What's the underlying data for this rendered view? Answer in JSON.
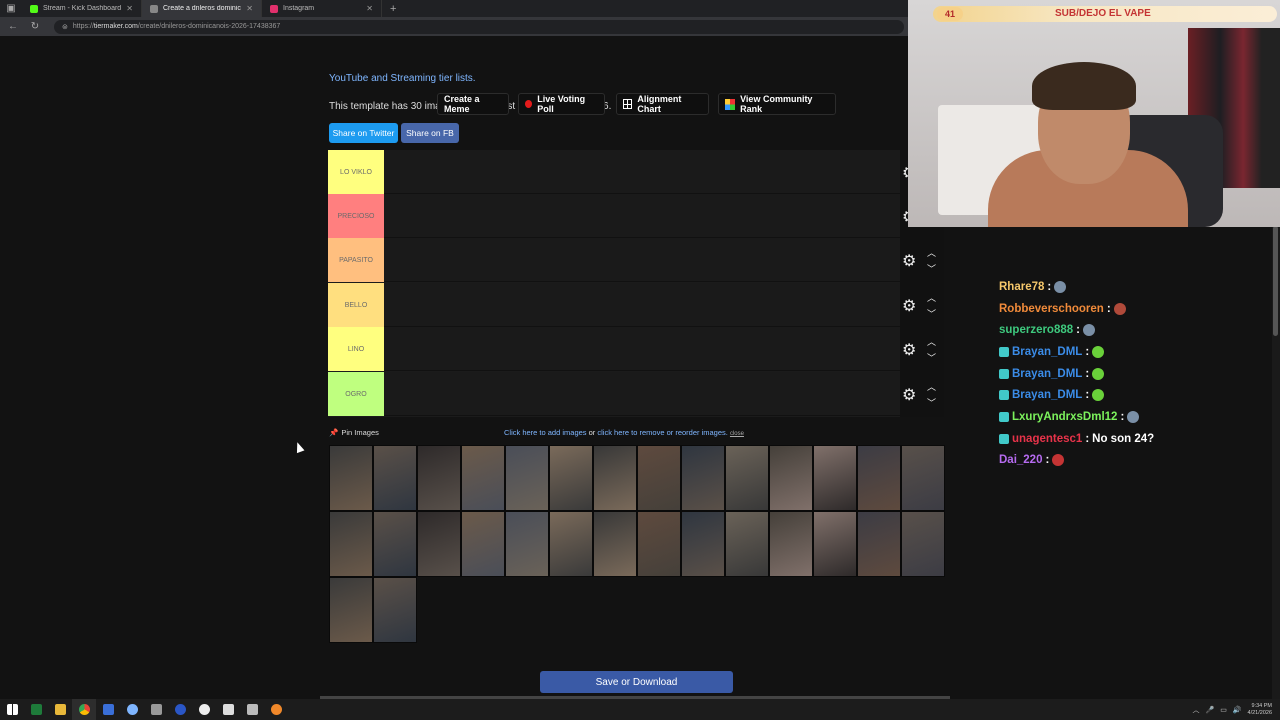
{
  "browser": {
    "tabs": [
      {
        "label": "Stream - Kick Dashboard",
        "color": "#53fc18"
      },
      {
        "label": "Create a dnleros dominicanois 20...",
        "color": "#888888"
      },
      {
        "label": "Instagram",
        "color": "#e1306c"
      }
    ],
    "url_domain": "tiermaker.com",
    "url_path": "/create/dnileros-dominicanois-2026-17438367",
    "url_prefix": "https://"
  },
  "page": {
    "link_text": "YouTube and Streaming tier lists.",
    "info_text": "This template has 30 images and was last modified 01/04/2026.",
    "buttons": {
      "create_meme": "Create a Meme",
      "live_poll": "Live Voting Poll",
      "alignment": "Alignment Chart",
      "community": "View Community Rank"
    },
    "share_twitter": "Share on Twitter",
    "share_fb": "Share on FB",
    "tiers": [
      {
        "label": "LO VIKLO",
        "color": "#ffff7f"
      },
      {
        "label": "PRECIOSO",
        "color": "#ff7f7f"
      },
      {
        "label": "PAPASITO",
        "color": "#ffbf7f"
      },
      {
        "label": "BELLO",
        "color": "#ffdf7f"
      },
      {
        "label": "LINO",
        "color": "#ffff7f"
      },
      {
        "label": "OGRO",
        "color": "#bfff7f"
      }
    ],
    "pin_images": "Pin Images",
    "add_images": "Click here to add images",
    "or": " or ",
    "remove_images": "click here to remove or reorder images.",
    "close": "close",
    "save": "Save or Download"
  },
  "overlay": {
    "sub_count": "41",
    "sub_goal": "SUB/DEJO EL VAPE"
  },
  "chat": [
    {
      "user": "Rhare78",
      "color": "#f5c76b",
      "badge": false,
      "text": "",
      "emote": "#7a8fa6"
    },
    {
      "user": "Robbeverschooren",
      "color": "#f08a3a",
      "badge": false,
      "text": "",
      "emote": "#b04a3a"
    },
    {
      "user": "superzero888",
      "color": "#3ec97e",
      "badge": false,
      "text": "",
      "emote": "#7a8fa6"
    },
    {
      "user": "Brayan_DML",
      "color": "#3b8ce8",
      "badge": true,
      "text": "",
      "emote": "#6ad13a"
    },
    {
      "user": "Brayan_DML",
      "color": "#3b8ce8",
      "badge": true,
      "text": "",
      "emote": "#6ad13a"
    },
    {
      "user": "Brayan_DML",
      "color": "#3b8ce8",
      "badge": true,
      "text": "",
      "emote": "#6ad13a"
    },
    {
      "user": "LxuryAndrxsDml12",
      "color": "#7cf25c",
      "badge": true,
      "text": "",
      "emote": "#7a8fa6"
    },
    {
      "user": "unagentesc1",
      "color": "#e8334a",
      "badge": true,
      "text": "No son 24?",
      "emote": ""
    },
    {
      "user": "Dai_220",
      "color": "#b66bf0",
      "badge": false,
      "text": "",
      "emote": "#c43434"
    }
  ],
  "taskbar": {
    "time": "9:34 PM",
    "date": "4/21/2026"
  }
}
